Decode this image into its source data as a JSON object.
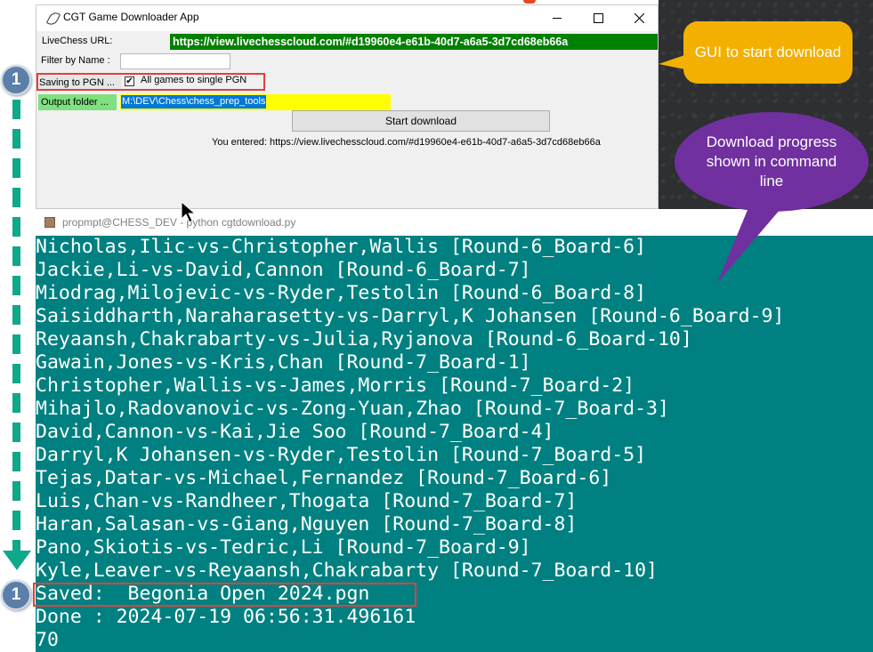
{
  "app_window": {
    "title": "CGT Game Downloader App",
    "url_label": "LiveChess URL:",
    "url_value": "https://view.livechesscloud.com/#d19960e4-e61b-40d7-a6a5-3d7cd68eb66a",
    "filter_label": "Filter by Name :",
    "filter_value": "",
    "pgn_button_label": "Saving to PGN ...",
    "single_pgn_checked": true,
    "single_pgn_label": "All games to single PGN",
    "output_button_label": "Output folder ...",
    "output_folder_value": "M:\\DEV\\Chess\\chess_prep_tools",
    "start_button_label": "Start download",
    "entered_text": "You entered: https://view.livechesscloud.com/#d19960e4-e61b-40d7-a6a5-3d7cd68eb66a"
  },
  "terminal": {
    "title": "propmpt@CHESS_DEV - python  cgtdownload.py",
    "lines": [
      "Nicholas,Ilic-vs-Christopher,Wallis [Round-6_Board-6]",
      "Jackie,Li-vs-David,Cannon [Round-6_Board-7]",
      "Miodrag,Milojevic-vs-Ryder,Testolin [Round-6_Board-8]",
      "Saisiddharth,Naraharasetty-vs-Darryl,K Johansen [Round-6_Board-9]",
      "Reyaansh,Chakrabarty-vs-Julia,Ryjanova [Round-6_Board-10]",
      "Gawain,Jones-vs-Kris,Chan [Round-7_Board-1]",
      "Christopher,Wallis-vs-James,Morris [Round-7_Board-2]",
      "Mihajlo,Radovanovic-vs-Zong-Yuan,Zhao [Round-7_Board-3]",
      "David,Cannon-vs-Kai,Jie Soo [Round-7_Board-4]",
      "Darryl,K Johansen-vs-Ryder,Testolin [Round-7_Board-5]",
      "Tejas,Datar-vs-Michael,Fernandez [Round-7_Board-6]",
      "Luis,Chan-vs-Randheer,Thogata [Round-7_Board-7]",
      "Haran,Salasan-vs-Giang,Nguyen [Round-7_Board-8]",
      "Pano,Skiotis-vs-Tedric,Li [Round-7_Board-9]",
      "Kyle,Leaver-vs-Reyaansh,Chakrabarty [Round-7_Board-10]",
      "Saved:  Begonia Open 2024.pgn",
      "Done : 2024-07-19 06:56:31.496161",
      "70"
    ]
  },
  "annotations": {
    "gui_callout": "GUI to start download",
    "progress_callout_lines": [
      "Download progress",
      "shown in command",
      "line"
    ],
    "badge_top": "1",
    "badge_bottom": "1"
  },
  "colors": {
    "terminal_bg": "#008080",
    "url_entry_bg": "#008000",
    "output_button_bg": "#7ee07e",
    "folder_entry_bg": "#ffff00",
    "highlight_red": "#e0403a",
    "gold_callout": "#f4b000",
    "purple_callout": "#7030a0",
    "arrow_green": "#0fa88a"
  },
  "icons": [
    "feather-icon",
    "minimize-icon",
    "maximize-icon",
    "close-icon",
    "terminal-icon",
    "mouse-cursor-icon",
    "checkbox-check-icon"
  ]
}
